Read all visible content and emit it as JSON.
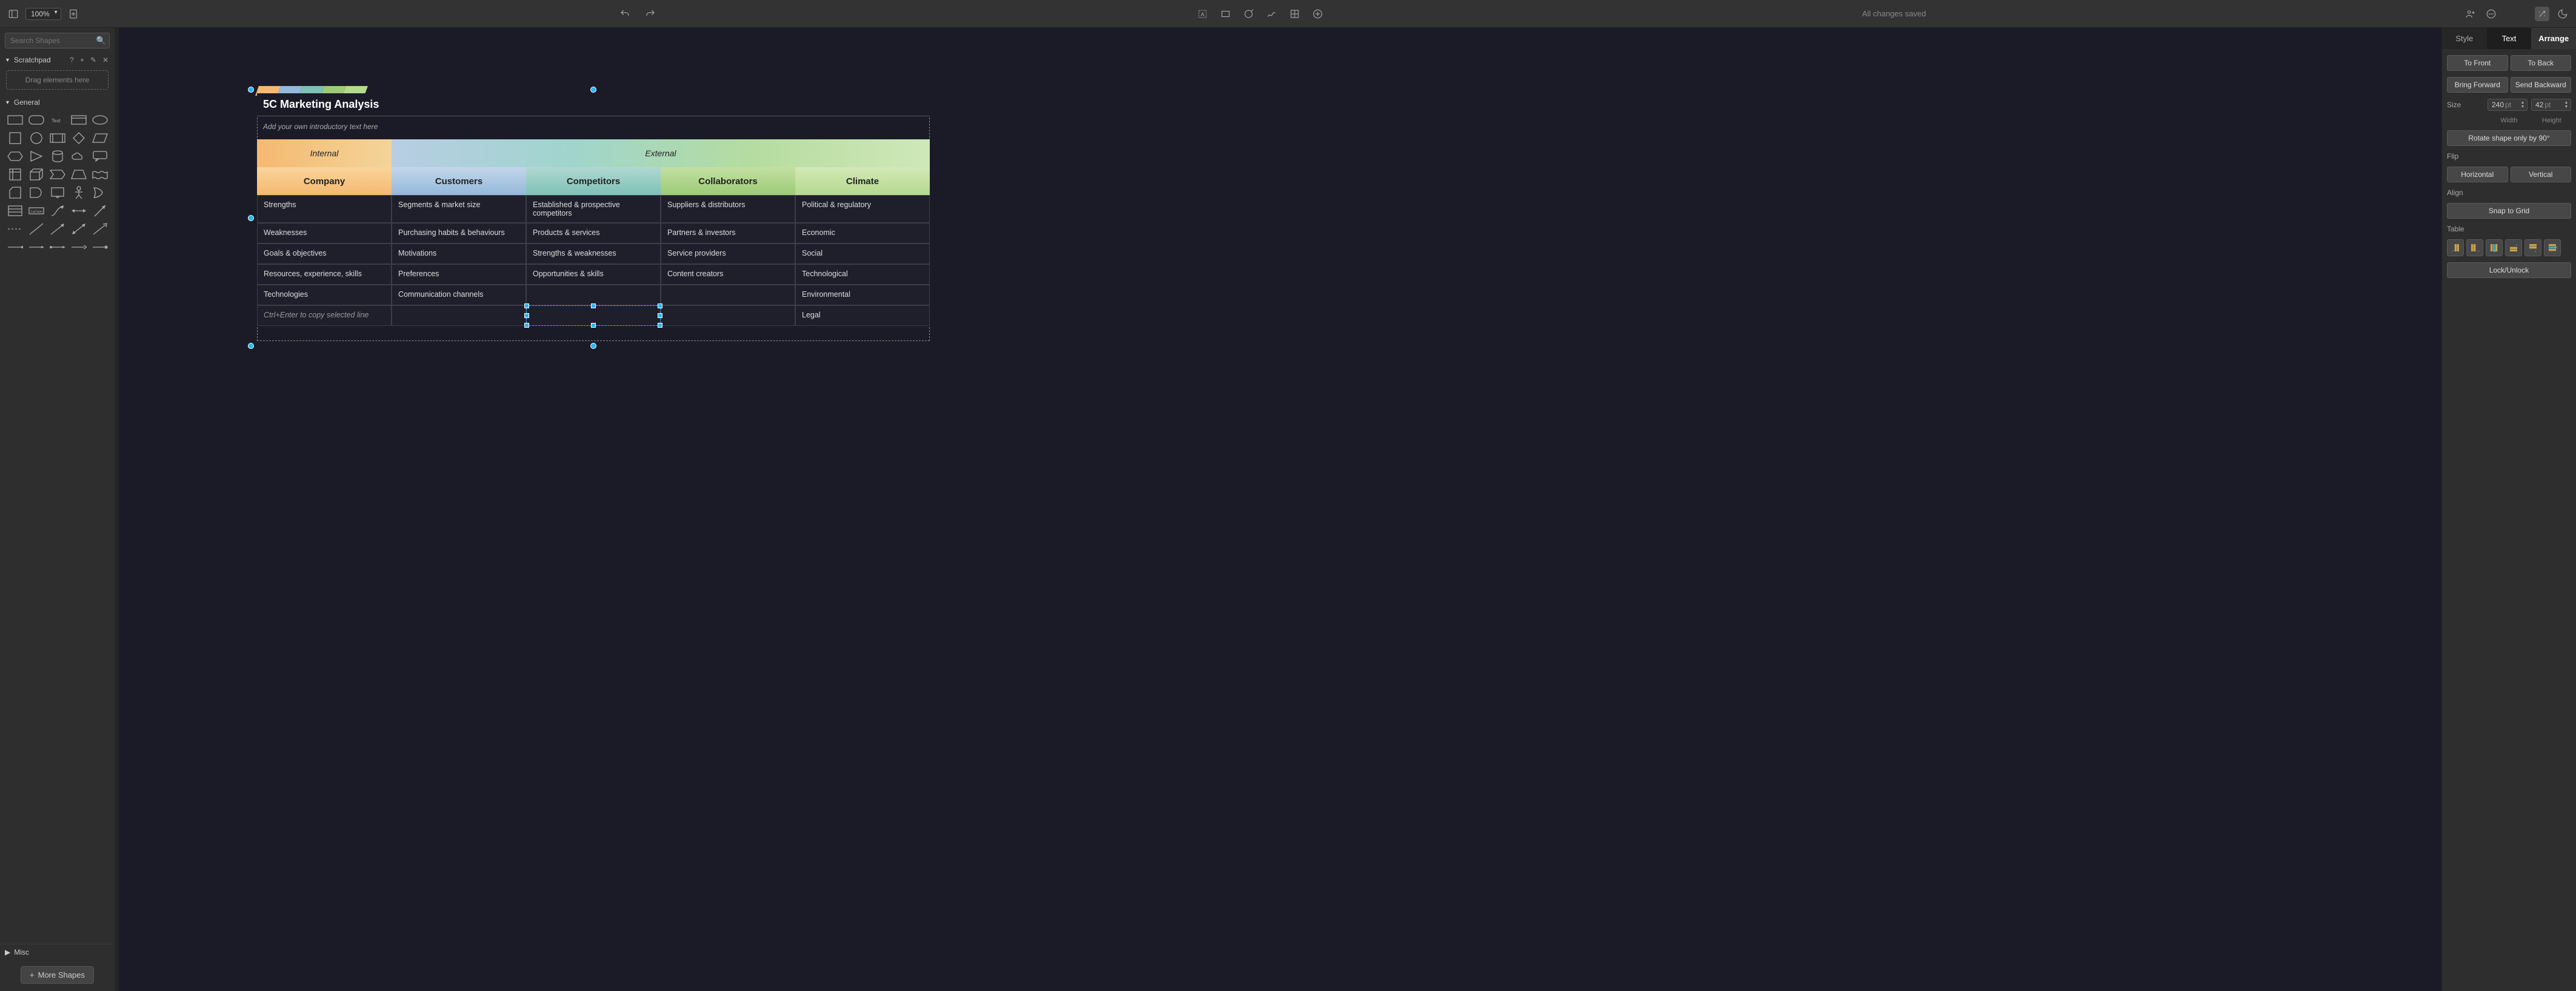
{
  "toolbar": {
    "zoom": "100%",
    "save_status": "All changes saved"
  },
  "sidebar_left": {
    "search_placeholder": "Search Shapes",
    "scratchpad": {
      "title": "Scratchpad",
      "drag_hint": "Drag elements here"
    },
    "general_title": "General",
    "misc_title": "Misc",
    "more_shapes": "More Shapes"
  },
  "canvas": {
    "title": "5C Marketing Analysis",
    "intro": "Add your own introductory text here",
    "group_headers": {
      "internal": "Internal",
      "external": "External"
    },
    "columns": [
      "Company",
      "Customers",
      "Competitors",
      "Collaborators",
      "Climate"
    ],
    "rows": [
      [
        "Strengths",
        "Segments & market size",
        "Established & prospective competitors",
        "Suppliers & distributors",
        "Political & regulatory"
      ],
      [
        "Weaknesses",
        "Purchasing habits & behaviours",
        "Products & services",
        "Partners & investors",
        "Economic"
      ],
      [
        "Goals & objectives",
        "Motivations",
        "Strengths & weaknesses",
        "Service providers",
        "Social"
      ],
      [
        "Resources, experience, skills",
        "Preferences",
        "Opportunities & skills",
        "Content creators",
        "Technological"
      ],
      [
        "Technologies",
        "Communication channels",
        "",
        "",
        "Environmental"
      ],
      [
        "",
        "",
        "",
        "",
        "Legal"
      ]
    ],
    "copy_hint": "Ctrl+Enter to copy selected line"
  },
  "sidebar_right": {
    "tabs": {
      "style": "Style",
      "text": "Text",
      "arrange": "Arrange"
    },
    "to_front": "To Front",
    "to_back": "To Back",
    "bring_forward": "Bring Forward",
    "send_backward": "Send Backward",
    "size_label": "Size",
    "width_value": "240",
    "height_value": "42",
    "unit": "pt",
    "width_label": "Width",
    "height_label": "Height",
    "rotate": "Rotate shape only by 90°",
    "flip_label": "Flip",
    "flip_h": "Horizontal",
    "flip_v": "Vertical",
    "align_label": "Align",
    "snap": "Snap to Grid",
    "table_label": "Table",
    "lock": "Lock/Unlock"
  }
}
